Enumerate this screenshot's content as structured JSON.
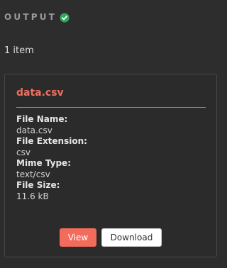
{
  "header": {
    "title": "OUTPUT",
    "status_icon": "check-circle-icon",
    "status_color": "#2eaa5c"
  },
  "summary": {
    "count_text": "1 item"
  },
  "file_card": {
    "title": "data.csv",
    "title_color": "#f07060",
    "fields": [
      {
        "label": "File Name:",
        "value": "data.csv"
      },
      {
        "label": "File Extension:",
        "value": "csv"
      },
      {
        "label": "Mime Type:",
        "value": "text/csv"
      },
      {
        "label": "File Size:",
        "value": "11.6 kB"
      }
    ],
    "actions": {
      "view_label": "View",
      "download_label": "Download"
    }
  },
  "colors": {
    "background": "#2d2d2d",
    "accent": "#f26b5b"
  }
}
